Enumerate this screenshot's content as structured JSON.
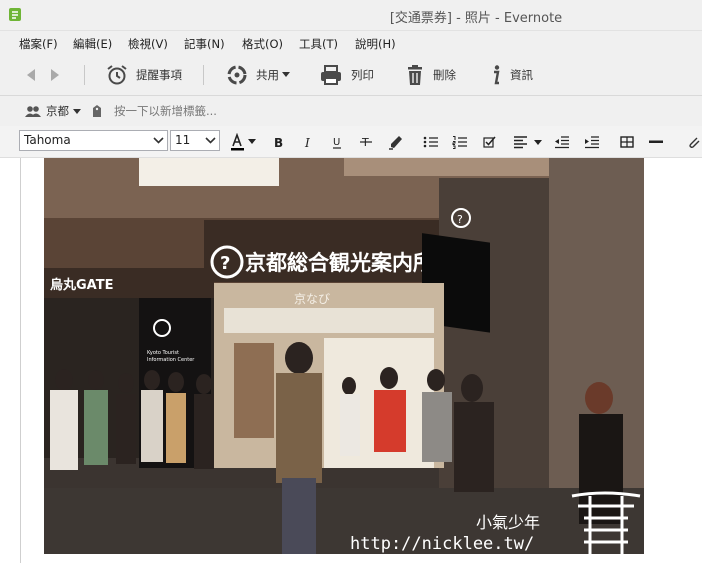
{
  "window": {
    "title": "[交通票券] - 照片 - Evernote"
  },
  "menu": [
    "檔案(F)",
    "編輯(E)",
    "檢視(V)",
    "記事(N)",
    "格式(O)",
    "工具(T)",
    "說明(H)"
  ],
  "toolbar": {
    "reminder": "提醒事項",
    "share": "共用",
    "print": "列印",
    "delete": "刪除",
    "info": "資訊"
  },
  "tags": {
    "notebook": "京都",
    "placeholder": "按一下以新增標籤..."
  },
  "format": {
    "font": "Tahoma",
    "size": "11"
  },
  "photo": {
    "sign_main": "京都総合観光案内所",
    "sign_sub": "京なび",
    "sign_gate": "烏丸GATE",
    "sign_small_1": "Kyoto Tourist",
    "sign_small_2": "Information Center",
    "watermark_name": "小氣少年",
    "watermark_url": "http://nicklee.tw/"
  },
  "colors": {
    "chrome": "#f0f0f0",
    "accent": "#4a4a4a",
    "evernote_green": "#6fb536"
  },
  "icons": [
    "evernote-app-icon",
    "back-arrow-icon",
    "forward-arrow-icon",
    "reminder-alarm-icon",
    "share-icon",
    "printer-icon",
    "trash-icon",
    "info-icon",
    "people-icon",
    "tag-icon"
  ]
}
